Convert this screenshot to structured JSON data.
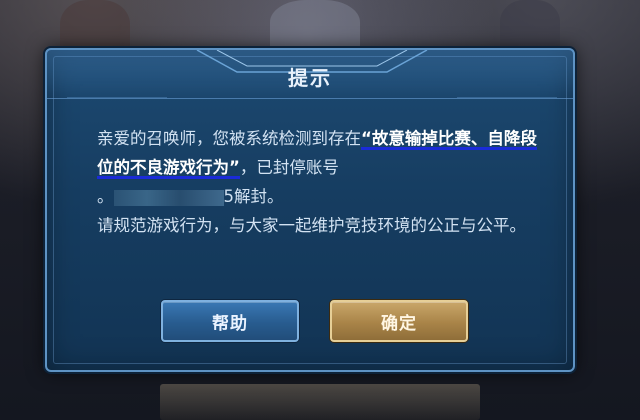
{
  "dialog": {
    "title": "提示",
    "message_lines": [
      "亲爱的召唤师，您被系统检测到存在“故意输掉比赛、自降段位的不良游戏行为”，已封停账号",
      "。",
      "5解封。",
      "请规范游戏行为，与大家一起维护竞技环境的公正与公平。"
    ],
    "message_parts": {
      "intro": "亲爱的召唤师，您被系统检测到存在",
      "highlighted": "“故意输掉比赛、自降段位的不良游戏行为”",
      "after_highlight": "，已封停账号",
      "period_start": "。",
      "unblock_suffix": "5解封。",
      "second_paragraph": "请规范游戏行为，与大家一起维护竞技环境的公正与公平。"
    },
    "buttons": {
      "help_label": "帮助",
      "confirm_label": "确定"
    }
  },
  "colors": {
    "dialog_bg": "#163d61",
    "dialog_border": "#5e93c4",
    "help_button": "#285c8f",
    "confirm_button": "#a98448",
    "highlight_underline": "#1a2bd8"
  }
}
